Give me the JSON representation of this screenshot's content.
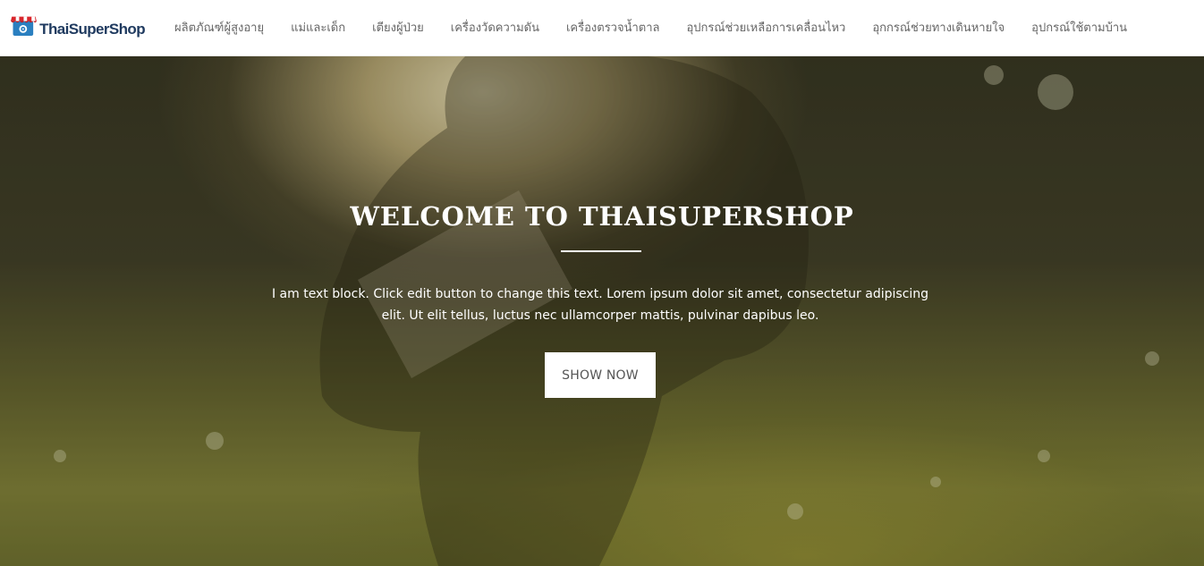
{
  "brand": {
    "name": "ThaiSuperShop",
    "icon": "store-awning-logo-icon",
    "colors": {
      "awning_red": "#d9262c",
      "awning_white": "#ffffff",
      "text_navy": "#1f3a5f",
      "accent_blue": "#2a7fc0"
    }
  },
  "nav": {
    "items": [
      {
        "label": "ผลิตภัณฑ์ผู้สูงอายุ"
      },
      {
        "label": "แม่และเด็ก"
      },
      {
        "label": "เตียงผู้ป่วย"
      },
      {
        "label": "เครื่องวัดความดัน"
      },
      {
        "label": "เครื่องตรวจน้ำตาล"
      },
      {
        "label": "อุปกรณ์ช่วยเหลือการเคลื่อนไหว"
      },
      {
        "label": "อุกกรณ์ช่วยทางเดินหายใจ"
      },
      {
        "label": "อุปกรณ์ใช้ตามบ้าน"
      }
    ]
  },
  "hero": {
    "title": "WELCOME TO THAISUPERSHOP",
    "text": "I am text block. Click edit button to change this text. Lorem ipsum dolor sit amet, consectetur adipiscing elit. Ut elit tellus, luctus nec ullamcorper mattis, pulvinar dapibus leo.",
    "cta_label": "SHOW NOW",
    "background_colors": {
      "light": "#f6e9c4",
      "shadow": "#3b3a26",
      "grass": "#8a8a3e"
    }
  }
}
